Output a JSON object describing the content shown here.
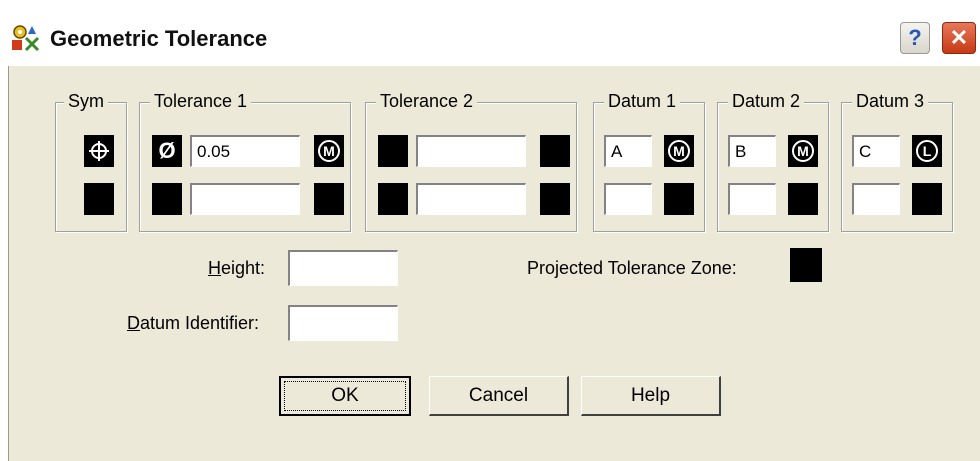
{
  "window": {
    "title": "Geometric Tolerance",
    "help_glyph": "?",
    "close_glyph": "✕"
  },
  "groups": {
    "sym": {
      "label": "Sym",
      "row1_symbol": "⌖",
      "row1_icon": "position-symbol-icon"
    },
    "tolerance1": {
      "label": "Tolerance 1",
      "dia_glyph": "Ø",
      "value1": "0.05",
      "value2": "",
      "mc1_glyph": "M",
      "mc1_icon": "max-material-condition-icon"
    },
    "tolerance2": {
      "label": "Tolerance 2",
      "value1": "",
      "value2": ""
    },
    "datum1": {
      "label": "Datum 1",
      "value1": "A",
      "value2": "",
      "mc1_glyph": "M"
    },
    "datum2": {
      "label": "Datum 2",
      "value1": "B",
      "value2": "",
      "mc1_glyph": "M"
    },
    "datum3": {
      "label": "Datum 3",
      "value1": "C",
      "value2": "",
      "mc1_glyph": "L",
      "mc1_icon": "least-material-condition-icon"
    }
  },
  "fields": {
    "height_prefix": "H",
    "height_rest": "eight:",
    "height_value": "",
    "datum_id_prefix": "D",
    "datum_id_rest": "atum Identifier:",
    "datum_id_value": "",
    "projected_label": "Projected Tolerance Zone:"
  },
  "buttons": {
    "ok": "OK",
    "cancel": "Cancel",
    "help": "Help"
  },
  "colors": {
    "dialog_bg": "#ece9d8",
    "close_red": "#c63a14"
  }
}
